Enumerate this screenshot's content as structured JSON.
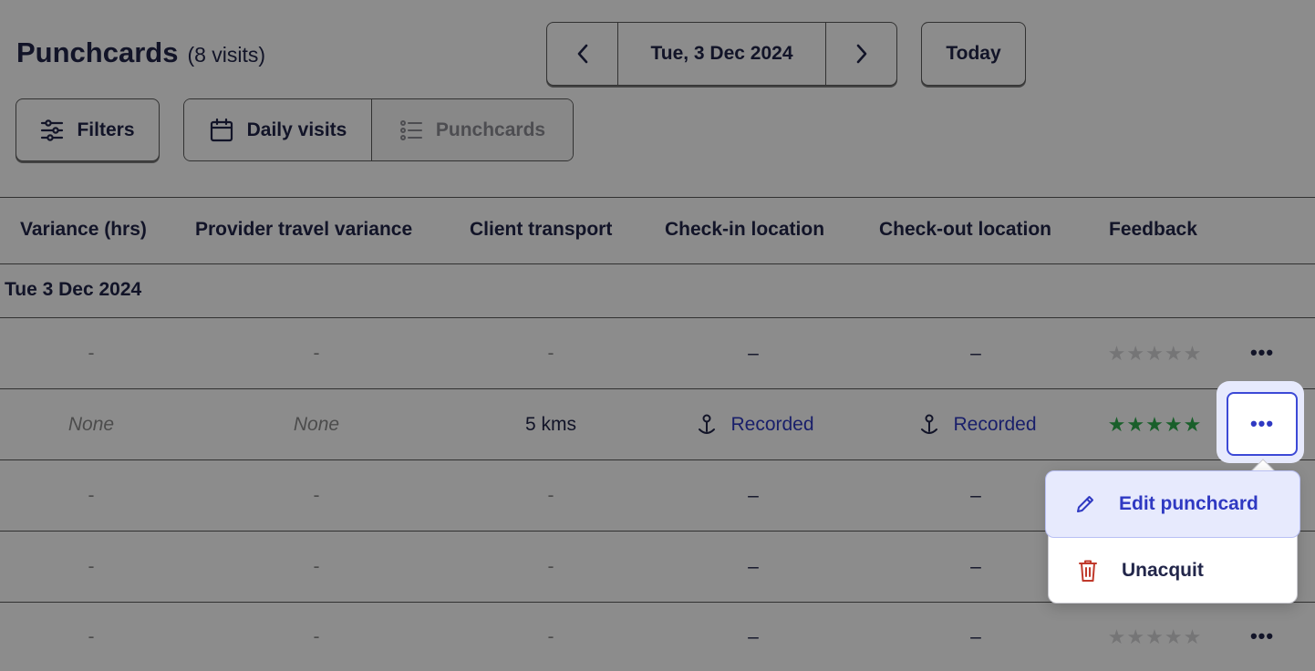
{
  "header": {
    "title": "Punchcards",
    "count": "(8 visits)",
    "date": "Tue, 3 Dec 2024",
    "today_label": "Today",
    "filters_label": "Filters",
    "view_daily_label": "Daily visits",
    "view_punchcards_label": "Punchcards"
  },
  "table": {
    "columns": [
      "Variance (hrs)",
      "Provider travel variance",
      "Client transport",
      "Check-in location",
      "Check-out location",
      "Feedback"
    ],
    "group_label": "Tue 3 Dec 2024",
    "rows": [
      {
        "variance": "-",
        "travel": "-",
        "transport": "-",
        "checkin": "–",
        "checkout": "–",
        "rating": 0,
        "more": "•••"
      },
      {
        "variance": "None",
        "travel": "None",
        "transport": "5 kms",
        "checkin": "Recorded",
        "checkout": "Recorded",
        "rating": 5,
        "more": "•••"
      },
      {
        "variance": "-",
        "travel": "-",
        "transport": "-",
        "checkin": "–",
        "checkout": "–",
        "rating": 0,
        "more": "•••"
      },
      {
        "variance": "-",
        "travel": "-",
        "transport": "-",
        "checkin": "–",
        "checkout": "–",
        "rating": 0,
        "more": "•••"
      },
      {
        "variance": "-",
        "travel": "-",
        "transport": "-",
        "checkin": "–",
        "checkout": "–",
        "rating": 0,
        "more": "•••"
      }
    ]
  },
  "menu": {
    "edit_label": "Edit punchcard",
    "unacquit_label": "Unacquit"
  },
  "colors": {
    "accent": "#2f39c2",
    "text": "#22264a",
    "star_on": "#2fae4e",
    "star_off": "#d5d5d8",
    "danger": "#c0392b"
  },
  "icons": {
    "prev": "chevron-left-icon",
    "next": "chevron-right-icon",
    "filters": "sliders-icon",
    "daily": "calendar-icon",
    "punchcards": "list-icon",
    "location": "map-pin-icon",
    "star": "star-icon",
    "more": "more-horizontal-icon",
    "edit": "pencil-icon",
    "delete": "trash-icon"
  }
}
